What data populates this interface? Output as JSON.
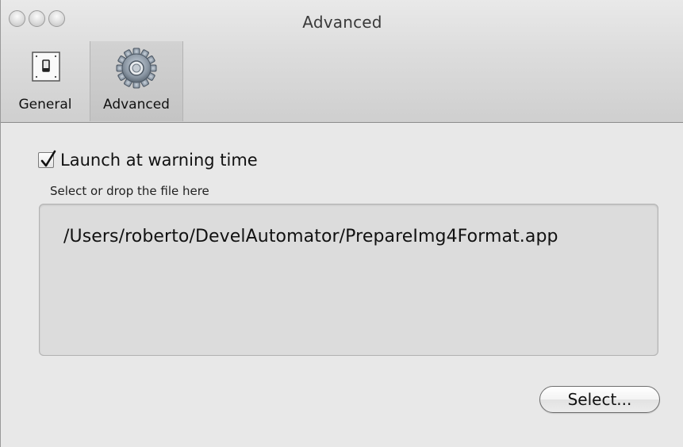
{
  "window": {
    "title": "Advanced"
  },
  "toolbar": {
    "items": [
      {
        "label": "General",
        "icon": "switch-icon",
        "selected": false
      },
      {
        "label": "Advanced",
        "icon": "gear-icon",
        "selected": true
      }
    ]
  },
  "advanced": {
    "launch_checkbox": {
      "label": "Launch at warning time",
      "checked": true
    },
    "drop_hint": "Select or drop the file here",
    "file_path": "/Users/roberto/DevelAutomator/PrepareImg4Format.app",
    "select_button_label": "Select..."
  },
  "colors": {
    "titlebar_top": "#e9e9e9",
    "titlebar_bottom": "#cfcfcf",
    "content_bg": "#e8e8e8",
    "field_bg": "#dcdcdc"
  }
}
